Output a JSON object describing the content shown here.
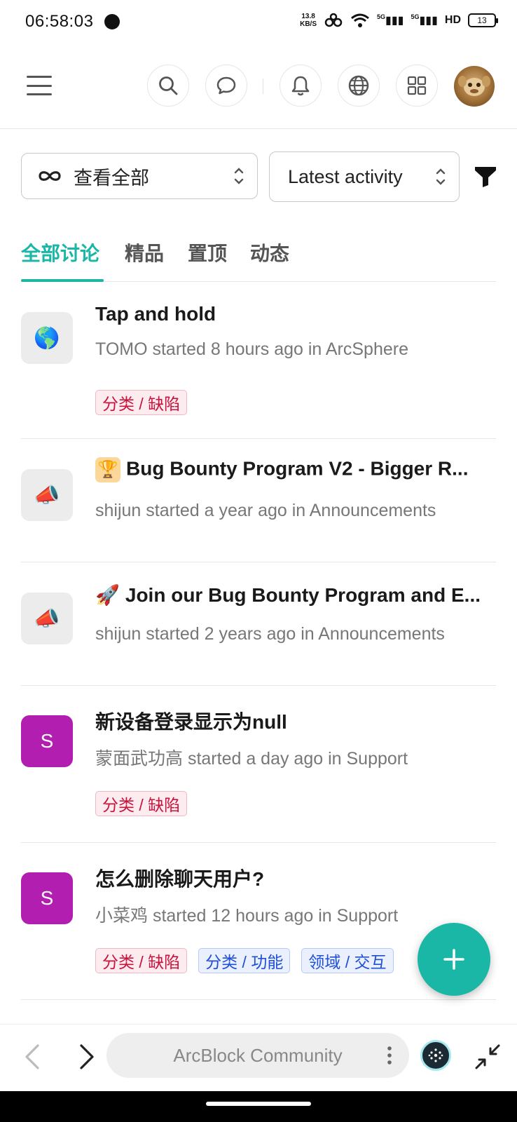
{
  "status_bar": {
    "time": "06:58:03",
    "net_speed_value": "13.8",
    "net_speed_unit": "KB/S",
    "signal_1": "5G",
    "signal_2": "5G",
    "hd": "HD",
    "battery": "13"
  },
  "top_nav": {
    "icons": [
      "menu-icon",
      "search-icon",
      "chat-icon",
      "bell-icon",
      "globe-icon",
      "apps-icon",
      "avatar"
    ]
  },
  "filters": {
    "scope_label": "查看全部",
    "sort_label": "Latest activity"
  },
  "tabs": [
    {
      "label": "全部讨论",
      "active": true
    },
    {
      "label": "精品",
      "active": false
    },
    {
      "label": "置顶",
      "active": false
    },
    {
      "label": "动态",
      "active": false
    }
  ],
  "discussions": [
    {
      "icon": "🌎",
      "title": "Tap and hold",
      "meta": "TOMO started 8 hours ago in ArcSphere",
      "tags": [
        {
          "label": "分类 / 缺陷",
          "color": "red"
        }
      ]
    },
    {
      "icon": "📣",
      "title_emoji": "🏆",
      "title": "Bug Bounty Program V2 - Bigger R...",
      "meta": "shijun started a year ago in Announcements",
      "tags": []
    },
    {
      "icon": "📣",
      "title_emoji": "🚀",
      "title": "Join our Bug Bounty Program and E...",
      "meta": "shijun started 2 years ago in Announcements",
      "tags": []
    },
    {
      "icon": "S",
      "title": "新设备登录显示为null",
      "meta": "蒙面武功高 started a day ago in Support",
      "tags": [
        {
          "label": "分类 / 缺陷",
          "color": "red"
        }
      ]
    },
    {
      "icon": "S",
      "title": "怎么删除聊天用户?",
      "meta": "小菜鸡 started 12 hours ago in Support",
      "tags": [
        {
          "label": "分类 / 缺陷",
          "color": "red"
        },
        {
          "label": "分类 / 功能",
          "color": "blue"
        },
        {
          "label": "领域 / 交互",
          "color": "blue"
        }
      ]
    }
  ],
  "fab": {
    "icon": "plus-icon",
    "color": "#1ab6a6"
  },
  "browser_bar": {
    "url_text": "ArcBlock Community"
  },
  "colors": {
    "accent": "#1ab6a6",
    "tag_red": "#c8143c",
    "tag_blue": "#1f4fd6",
    "letter_avatar": "#b21fb0"
  }
}
